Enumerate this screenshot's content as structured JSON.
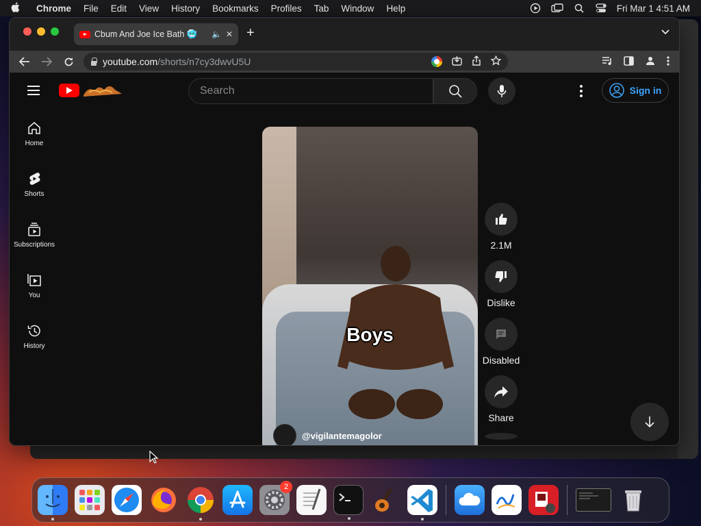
{
  "menubar": {
    "app": "Chrome",
    "items": [
      "File",
      "Edit",
      "View",
      "History",
      "Bookmarks",
      "Profiles",
      "Tab",
      "Window",
      "Help"
    ],
    "datetime": "Fri Mar 1  4:51 AM"
  },
  "browser": {
    "tab_title": "Cbum And Joe Ice Bath 🥶",
    "url_host": "youtube.com",
    "url_path": "/shorts/n7cy3dwvU5U"
  },
  "youtube": {
    "search_placeholder": "Search",
    "signin_label": "Sign in",
    "nav": [
      {
        "label": "Home",
        "icon": "home-icon"
      },
      {
        "label": "Shorts",
        "icon": "shorts-icon"
      },
      {
        "label": "Subscriptions",
        "icon": "subscriptions-icon"
      },
      {
        "label": "You",
        "icon": "you-icon"
      },
      {
        "label": "History",
        "icon": "history-icon"
      }
    ],
    "short": {
      "caption": "Boys",
      "channel": "@vigilantemagolor"
    },
    "actions": {
      "like_count": "2.1M",
      "dislike_label": "Dislike",
      "comments_label": "Disabled",
      "share_label": "Share"
    }
  },
  "dock": {
    "settings_badge": "2",
    "apps": [
      "finder-icon",
      "launchpad-icon",
      "safari-icon",
      "firefox-icon",
      "chrome-icon",
      "app-store-icon",
      "system-settings-icon",
      "textedit-icon",
      "terminal-icon",
      "garageband-icon",
      "vscode-icon",
      "icloud-icon",
      "freeform-icon",
      "photo-booth-icon",
      "window-thumbnail-icon",
      "trash-icon"
    ]
  },
  "colors": {
    "youtube_red": "#ff0000",
    "signin_blue": "#3ea6ff",
    "page_bg": "#0f0f0f"
  }
}
